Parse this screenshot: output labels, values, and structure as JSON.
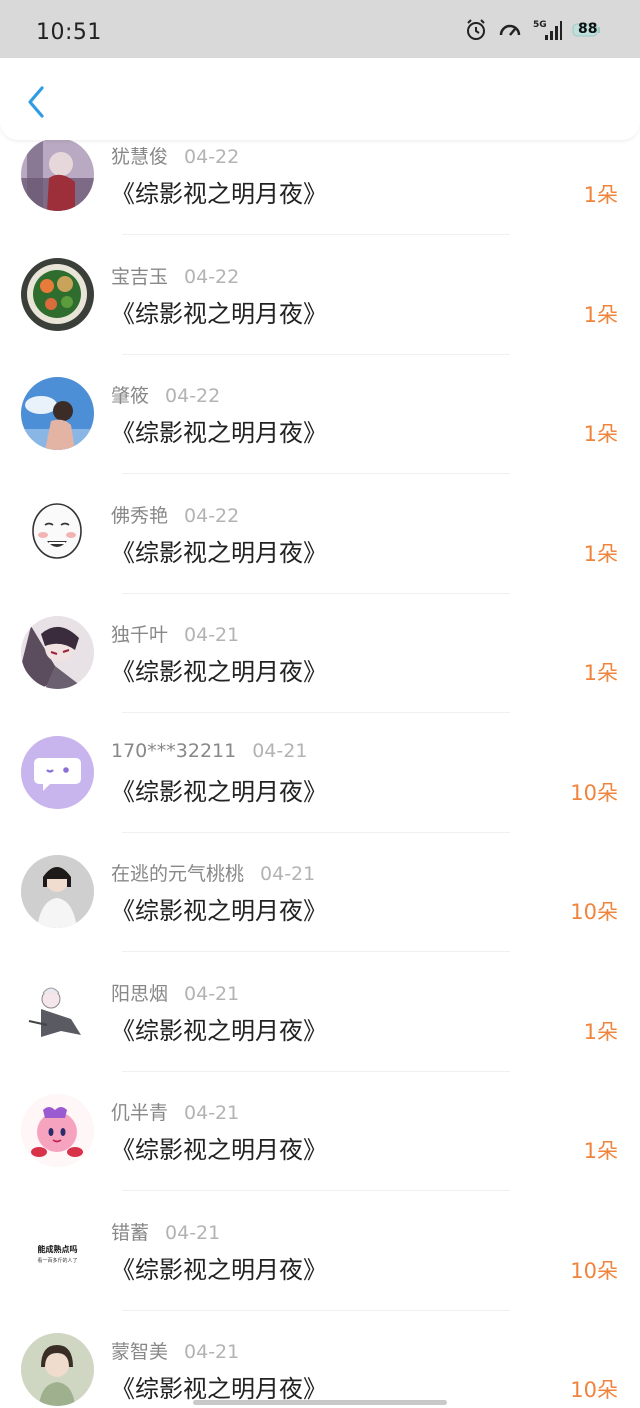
{
  "status_bar": {
    "time": "10:51",
    "network": "5G",
    "battery": "88",
    "icons": [
      "alarm-icon",
      "speedometer-icon",
      "signal-5g-icon",
      "battery-icon"
    ]
  },
  "header": {
    "back_icon": "chevron-left-icon",
    "accent": "#2f9de4"
  },
  "colors": {
    "count": "#f0843c",
    "date": "#b3b3b3",
    "name": "#888888",
    "title": "#222222"
  },
  "list": {
    "items": [
      {
        "name": "犹慧俊",
        "date": "04-22",
        "title": "《综影视之明月夜》",
        "count": "1朵",
        "avatar": "photo-avatar-purple"
      },
      {
        "name": "宝吉玉",
        "date": "04-22",
        "title": "《综影视之明月夜》",
        "count": "1朵",
        "avatar": "food-plate-avatar"
      },
      {
        "name": "肇筱",
        "date": "04-22",
        "title": "《综影视之明月夜》",
        "count": "1朵",
        "avatar": "sky-photo-avatar"
      },
      {
        "name": "佛秀艳",
        "date": "04-22",
        "title": "《综影视之明月夜》",
        "count": "1朵",
        "avatar": "meme-face-avatar"
      },
      {
        "name": "独千叶",
        "date": "04-21",
        "title": "《综影视之明月夜》",
        "count": "1朵",
        "avatar": "anime-avatar"
      },
      {
        "name": "170***32211",
        "date": "04-21",
        "title": "《综影视之明月夜》",
        "count": "10朵",
        "avatar": "default-chat-avatar"
      },
      {
        "name": "在逃的元气桃桃",
        "date": "04-21",
        "title": "《综影视之明月夜》",
        "count": "10朵",
        "avatar": "person-photo-avatar"
      },
      {
        "name": "阳思烟",
        "date": "04-21",
        "title": "《综影视之明月夜》",
        "count": "1朵",
        "avatar": "chibi-avatar"
      },
      {
        "name": "仉半青",
        "date": "04-21",
        "title": "《综影视之明月夜》",
        "count": "1朵",
        "avatar": "kirby-avatar"
      },
      {
        "name": "错蓄",
        "date": "04-21",
        "title": "《综影视之明月夜》",
        "count": "10朵",
        "avatar": "text-avatar",
        "avatar_text": [
          "能成熟点吗",
          "看一百多斤的人了"
        ]
      },
      {
        "name": "蒙智美",
        "date": "04-21",
        "title": "《综影视之明月夜》",
        "count": "10朵",
        "avatar": "portrait-avatar"
      }
    ]
  }
}
